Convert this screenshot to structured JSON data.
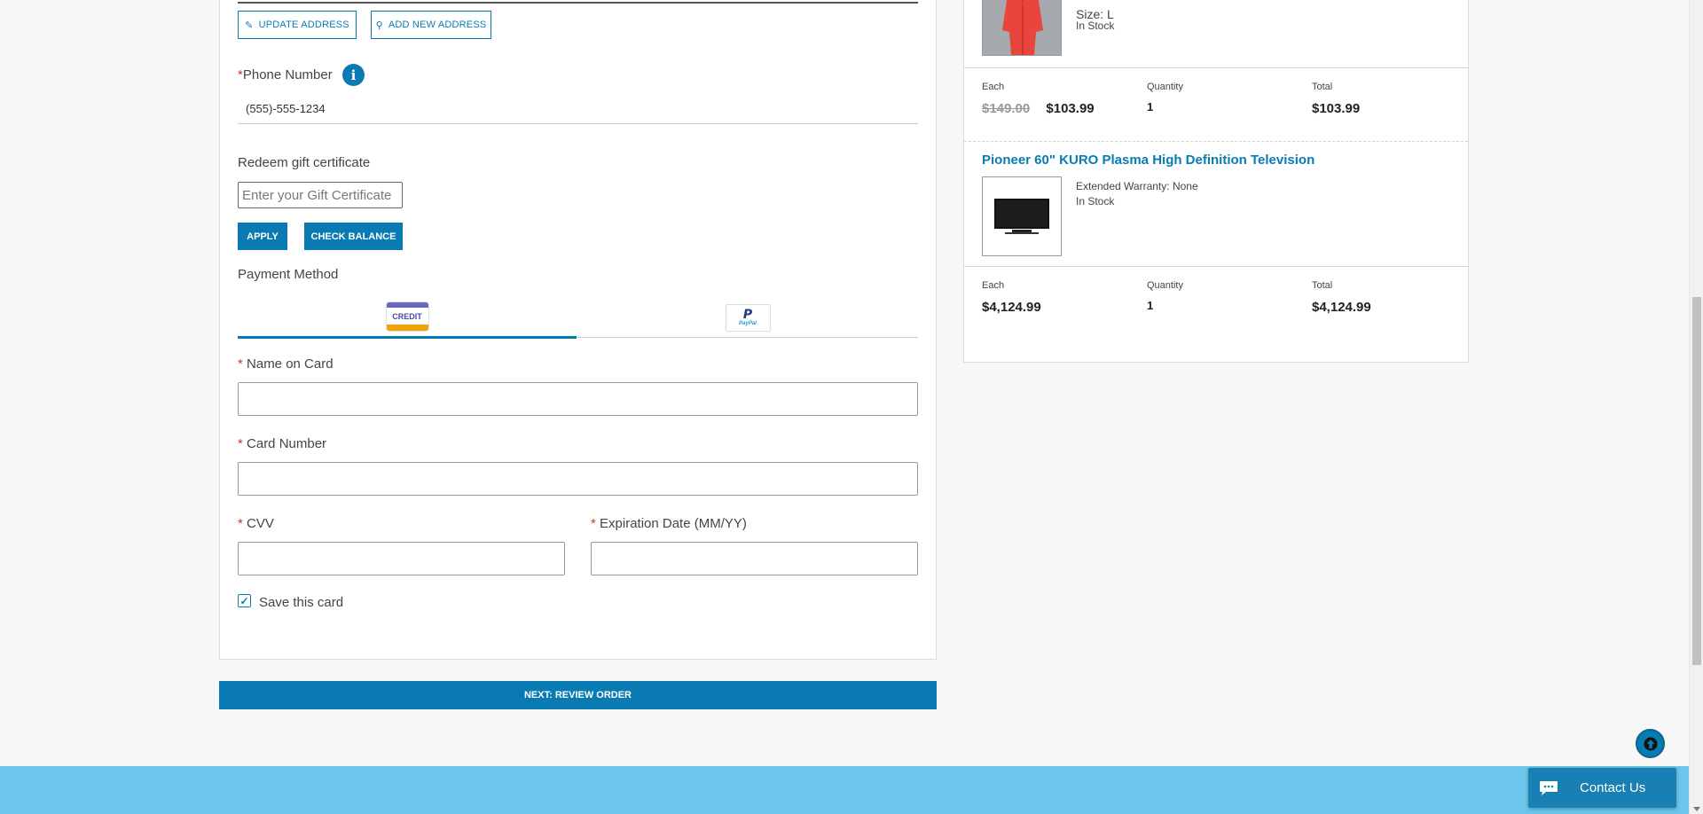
{
  "address_actions": {
    "update_label": "UPDATE ADDRESS",
    "add_new_label": "ADD NEW ADDRESS"
  },
  "phone": {
    "required_mark": "*",
    "label": "Phone Number",
    "value": "(555)-555-1234",
    "info_glyph": "i"
  },
  "gift": {
    "label": "Redeem gift certificate",
    "placeholder": "Enter your Gift Certificate",
    "apply_label": "APPLY",
    "check_balance_label": "CHECK BALANCE"
  },
  "payment": {
    "label": "Payment Method",
    "credit_tab_text": "CREDIT",
    "paypal_tab_text": "PayPal",
    "selected_tab": "credit"
  },
  "card_form": {
    "required_mark": "*",
    "name_label": "Name on Card",
    "number_label": "Card Number",
    "cvv_label": "CVV",
    "expiration_label": "Expiration Date (MM/YY)",
    "save_label": "Save this card",
    "save_checked": true
  },
  "next_label": "NEXT: REVIEW ORDER",
  "order_summary": {
    "items": [
      {
        "name": "",
        "size": "Size: L",
        "stock": "In Stock",
        "each_label": "Each",
        "original_price": "$149.00",
        "price": "$103.99",
        "quantity_label": "Quantity",
        "quantity": "1",
        "total_label": "Total",
        "total": "$103.99"
      },
      {
        "name": "Pioneer 60\" KURO Plasma High Definition Television",
        "warranty": "Extended Warranty: None",
        "stock": "In Stock",
        "each_label": "Each",
        "price": "$4,124.99",
        "quantity_label": "Quantity",
        "quantity": "1",
        "total_label": "Total",
        "total": "$4,124.99"
      }
    ]
  },
  "contact": {
    "label": "Contact Us"
  },
  "colors": {
    "accent": "#0a7bb2",
    "footer": "#6cc5ea",
    "required": "#c0392b"
  }
}
